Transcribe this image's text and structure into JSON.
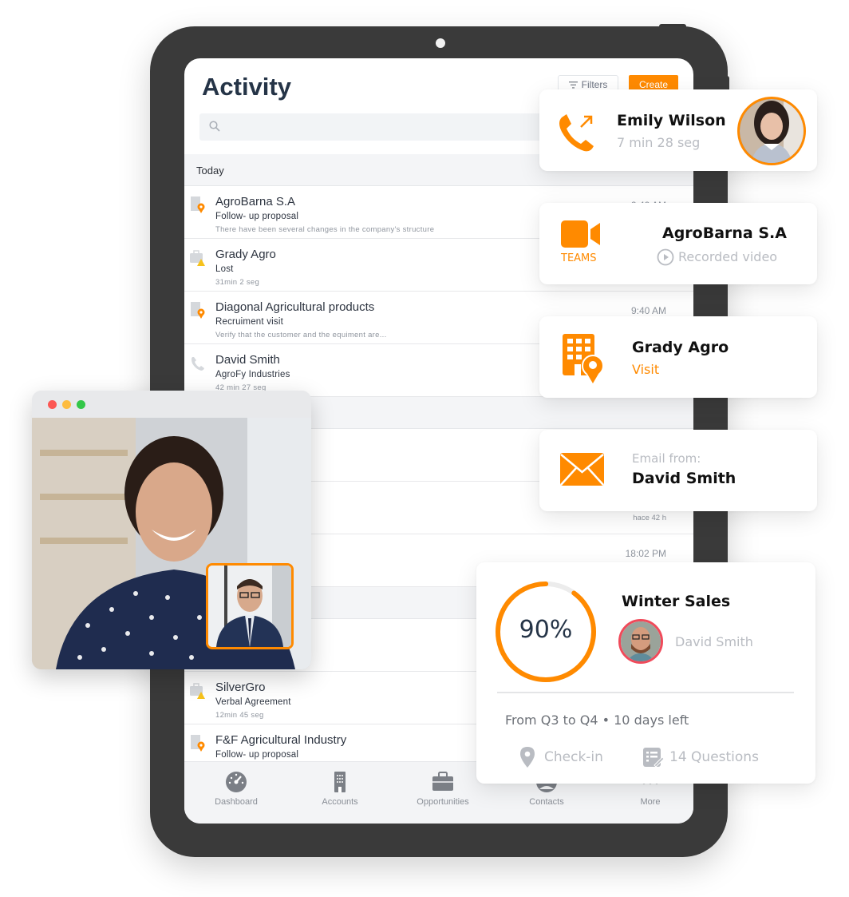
{
  "colors": {
    "accent": "#ff8a00",
    "title": "#253447",
    "muted": "#b9bcc2",
    "tablet": "#3a3a3a"
  },
  "app": {
    "title": "Activity",
    "filters_label": "Filters",
    "create_label": "Create",
    "search_placeholder": ""
  },
  "sections": [
    {
      "label": "Today"
    }
  ],
  "activities": [
    {
      "icon": "building-location-icon",
      "name": "AgroBarna S.A",
      "subtitle": "Follow- up proposal",
      "meta": "There have been several changes in the company's structure",
      "time": "9:40 AM"
    },
    {
      "icon": "briefcase-warning-icon",
      "name": "Grady Agro",
      "subtitle": "Lost",
      "meta": "31min 2 seg",
      "time": ""
    },
    {
      "icon": "building-location-icon",
      "name": "Diagonal Agricultural products",
      "subtitle": "Recruiment visit",
      "meta": "Verify that the customer and the equiment are...",
      "time": "9:40 AM"
    },
    {
      "icon": "phone-icon",
      "name": "David Smith",
      "subtitle": "AgroFy Industries",
      "meta": "42 min 27 seg",
      "time": ""
    },
    {
      "icon": "",
      "name": "",
      "subtitle": "",
      "meta": "",
      "time": "hace 42 h"
    },
    {
      "icon": "",
      "name": "",
      "subtitle": "",
      "meta": "",
      "time": "18:02 PM"
    },
    {
      "icon": "briefcase-warning-icon",
      "name": "SilverGro",
      "subtitle": "Verbal Agreement",
      "meta": "12min 45 seg",
      "time": ""
    },
    {
      "icon": "building-location-icon",
      "name": "F&F Agricultural Industry",
      "subtitle": "Follow- up proposal",
      "meta": "",
      "time": ""
    }
  ],
  "tabbar": [
    {
      "label": "Dashboard",
      "icon": "dashboard-gauge-icon"
    },
    {
      "label": "Accounts",
      "icon": "building-icon"
    },
    {
      "label": "Opportunities",
      "icon": "briefcase-icon"
    },
    {
      "label": "Contacts",
      "icon": "contact-icon"
    },
    {
      "label": "More",
      "icon": "more-dots-icon"
    }
  ],
  "cards": {
    "call": {
      "name": "Emily Wilson",
      "duration": "7 min 28 seg",
      "icon": "outgoing-call-icon"
    },
    "teams": {
      "badge": "TEAMS",
      "name": "AgroBarna S.A",
      "action": "Recorded video",
      "icon": "video-camera-icon"
    },
    "visit": {
      "name": "Grady Agro",
      "type": "Visit",
      "icon": "building-location-icon"
    },
    "email": {
      "label": "Email from:",
      "name": "David Smith",
      "icon": "envelope-icon"
    },
    "campaign": {
      "title": "Winter Sales",
      "progress_percent": 90,
      "progress_label": "90%",
      "owner": "David Smith",
      "period": "From Q3 to Q4 • 10 days left",
      "checkin_label": "Check-in",
      "questions_label": "14 Questions"
    }
  },
  "video_call": {
    "window_controls": [
      "close",
      "minimize",
      "maximize"
    ]
  }
}
